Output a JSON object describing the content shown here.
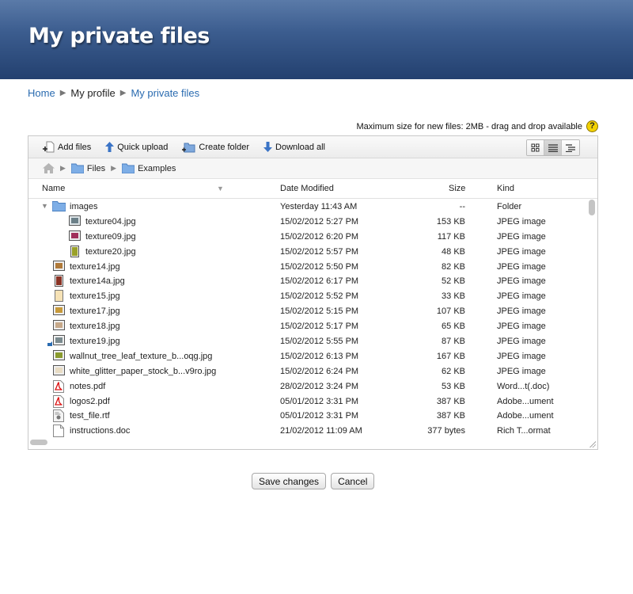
{
  "header": {
    "title": "My private files"
  },
  "breadcrumb": {
    "home": "Home",
    "profile": "My profile",
    "current": "My private files"
  },
  "notice": {
    "maxsize": "Maximum size for new files: 2MB - drag and drop available",
    "help": "?"
  },
  "toolbar": {
    "add_files": "Add files",
    "quick_upload": "Quick upload",
    "create_folder": "Create folder",
    "download_all": "Download all"
  },
  "path": {
    "files": "Files",
    "examples": "Examples"
  },
  "columns": {
    "name": "Name",
    "date": "Date Modified",
    "size": "Size",
    "kind": "Kind"
  },
  "rows": [
    {
      "name": "images",
      "date": "Yesterday 11:43 AM",
      "size": "--",
      "kind": "Folder",
      "icon": "folder-icon"
    },
    {
      "name": "texture04.jpg",
      "date": "15/02/2012 5:27 PM",
      "size": "153 KB",
      "kind": "JPEG image",
      "icon": "image-thumbnail-icon"
    },
    {
      "name": "texture09.jpg",
      "date": "15/02/2012 6:20 PM",
      "size": "117 KB",
      "kind": "JPEG image",
      "icon": "image-thumbnail-icon"
    },
    {
      "name": "texture20.jpg",
      "date": "15/02/2012 5:57 PM",
      "size": "48 KB",
      "kind": "JPEG image",
      "icon": "image-thumbnail-icon"
    },
    {
      "name": "texture14.jpg",
      "date": "15/02/2012 5:50 PM",
      "size": "82 KB",
      "kind": "JPEG image",
      "icon": "image-thumbnail-icon"
    },
    {
      "name": "texture14a.jpg",
      "date": "15/02/2012 6:17 PM",
      "size": "52 KB",
      "kind": "JPEG image",
      "icon": "image-thumbnail-icon"
    },
    {
      "name": "texture15.jpg",
      "date": "15/02/2012 5:52 PM",
      "size": "33 KB",
      "kind": "JPEG image",
      "icon": "image-thumbnail-icon"
    },
    {
      "name": "texture17.jpg",
      "date": "15/02/2012 5:15 PM",
      "size": "107 KB",
      "kind": "JPEG image",
      "icon": "image-thumbnail-icon"
    },
    {
      "name": "texture18.jpg",
      "date": "15/02/2012 5:17 PM",
      "size": "65 KB",
      "kind": "JPEG image",
      "icon": "image-thumbnail-icon"
    },
    {
      "name": "texture19.jpg",
      "date": "15/02/2012 5:55 PM",
      "size": "87 KB",
      "kind": "JPEG image",
      "icon": "image-alias-icon"
    },
    {
      "name": "wallnut_tree_leaf_texture_b...oqg.jpg",
      "date": "15/02/2012 6:13 PM",
      "size": "167 KB",
      "kind": "JPEG image",
      "icon": "image-thumbnail-icon"
    },
    {
      "name": "white_glitter_paper_stock_b...v9ro.jpg",
      "date": "15/02/2012 6:24 PM",
      "size": "62 KB",
      "kind": "JPEG image",
      "icon": "image-thumbnail-icon"
    },
    {
      "name": "notes.pdf",
      "date": "28/02/2012 3:24 PM",
      "size": "53 KB",
      "kind": "Word...t(.doc)",
      "icon": "pdf-icon"
    },
    {
      "name": "logos2.pdf",
      "date": "05/01/2012 3:31 PM",
      "size": "387 KB",
      "kind": "Adobe...ument",
      "icon": "pdf-icon"
    },
    {
      "name": "test_file.rtf",
      "date": "05/01/2012 3:31 PM",
      "size": "387 KB",
      "kind": "Adobe...ument",
      "icon": "document-icon"
    },
    {
      "name": "instructions.doc",
      "date": "21/02/2012 11:09 AM",
      "size": "377 bytes",
      "kind": "Rich T...ormat",
      "icon": "blank-document-icon"
    }
  ],
  "actions": {
    "save": "Save changes",
    "cancel": "Cancel"
  }
}
